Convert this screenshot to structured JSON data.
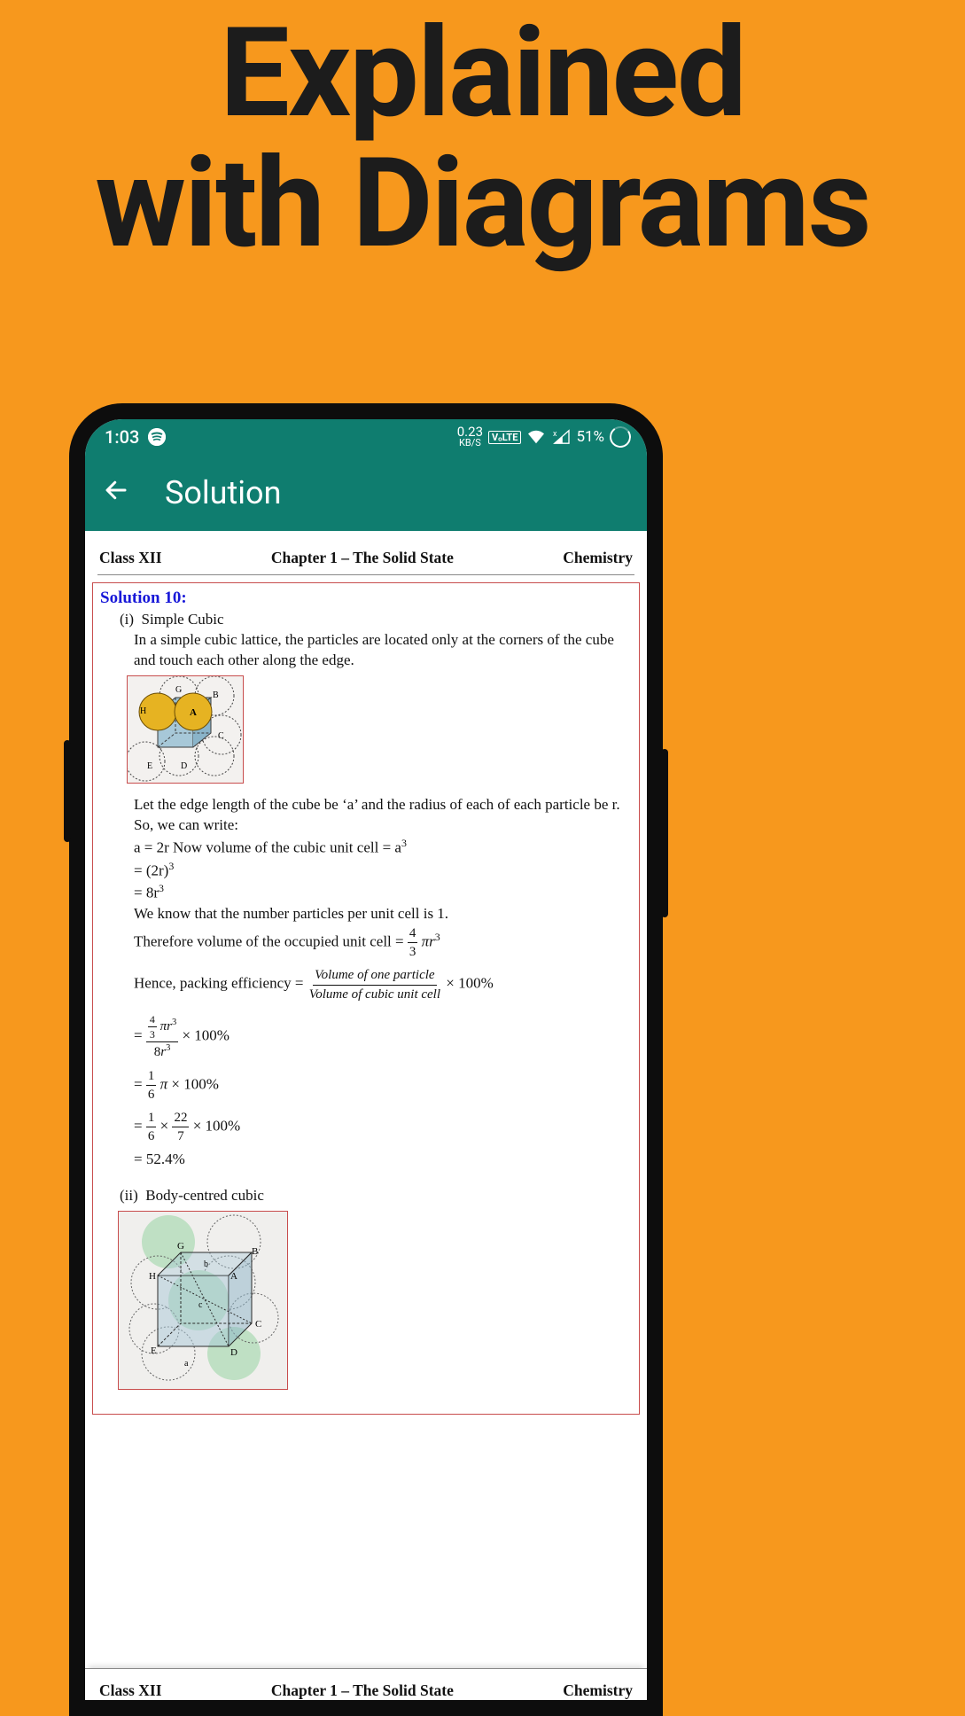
{
  "promo": {
    "line1": "Explained",
    "line2": "with Diagrams"
  },
  "status": {
    "time": "1:03",
    "speed_val": "0.23",
    "speed_unit": "KB/S",
    "volte": "VₒLTE",
    "battery": "51%"
  },
  "appbar": {
    "title": "Solution"
  },
  "header": {
    "left": "Class XII",
    "center": "Chapter 1 – The Solid State",
    "right": "Chemistry"
  },
  "solution": {
    "title": "Solution 10:",
    "item1_num": "(i)",
    "item1_name": "Simple Cubic",
    "p1": "In a simple cubic lattice, the particles are located only at the corners of the cube and touch each other along the edge.",
    "diagram1_labels": {
      "G": "G",
      "B": "B",
      "H": "H",
      "A": "A",
      "C": "C",
      "E": "E",
      "D": "D"
    },
    "p2": "Let the edge length of the cube be ‘a’ and the radius of each of each particle be r.",
    "p3": "So, we can write:",
    "p4": "a = 2r Now volume of the cubic unit cell = a³",
    "p5": "= (2r)³",
    "p6": "= 8r³",
    "p7": "We know that the number particles per unit cell is 1.",
    "p8a": "Therefore volume of the occupied unit cell = ",
    "frac_4_3": {
      "num": "4",
      "den": "3"
    },
    "pi_r3": "πr³",
    "p9a": "Hence, packing efficiency = ",
    "frac_pe": {
      "num": "Volume of one particle",
      "den": "Volume of cubic unit cell"
    },
    "times100": " × 100%",
    "eq_line1": {
      "top_num": "4",
      "top_den": "3",
      "pi_r3": "πr³",
      "bot": "8r³",
      "tail": " × 100%"
    },
    "eq_line2": {
      "num": "1",
      "den": "6",
      "tail": "π × 100%"
    },
    "eq_line3": {
      "n1": "1",
      "d1": "6",
      "times": " × ",
      "n2": "22",
      "d2": "7",
      "tail": " × 100%"
    },
    "eq_line4": "= 52.4%",
    "item2_num": "(ii)",
    "item2_name": "Body-centred cubic",
    "diagram2_labels": {
      "G": "G",
      "B": "B",
      "H": "H",
      "A": "A",
      "C": "C",
      "E": "E",
      "D": "D",
      "a": "a",
      "b": "b",
      "c": "c"
    }
  },
  "footer": {
    "left": "Class XII",
    "center": "Chapter 1 – The Solid State",
    "right": "Chemistry"
  }
}
